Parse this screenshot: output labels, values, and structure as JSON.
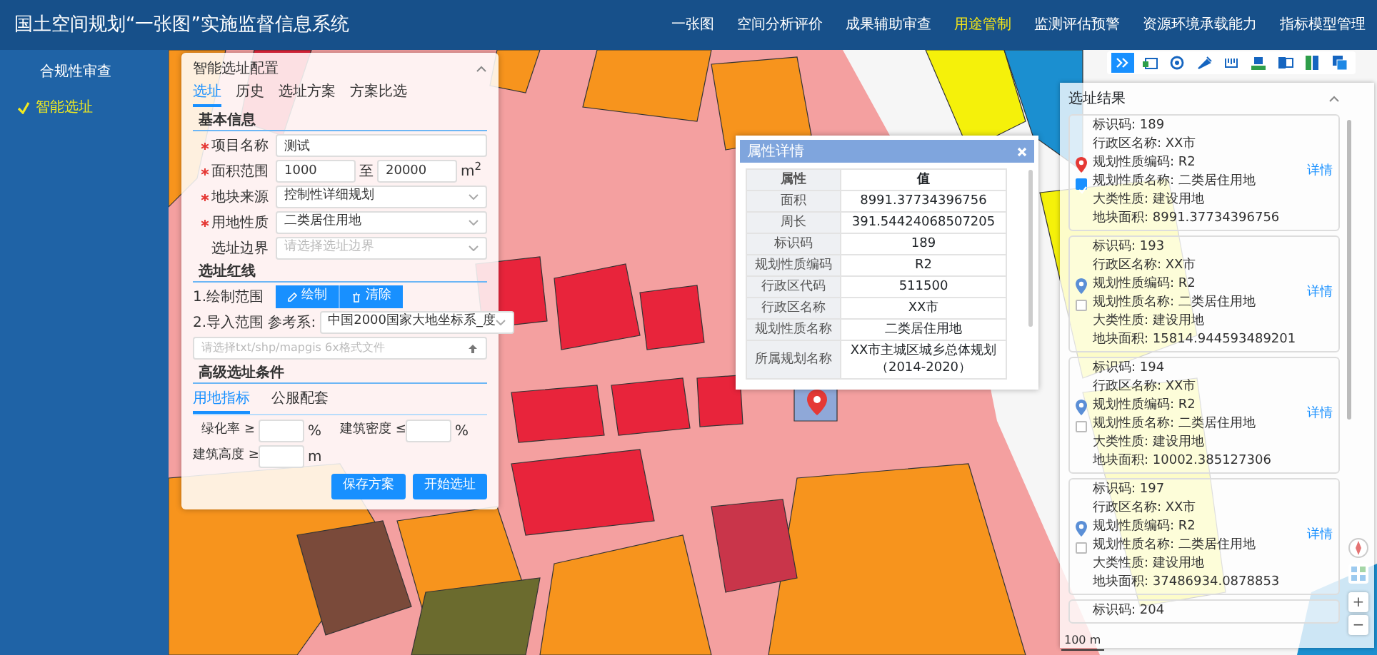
{
  "header": {
    "title": "国土空间规划“一张图”实施监督信息系统",
    "nav": [
      {
        "label": "一张图",
        "selected": false
      },
      {
        "label": "空间分析评价",
        "selected": false
      },
      {
        "label": "成果辅助审查",
        "selected": false
      },
      {
        "label": "用途管制",
        "selected": true
      },
      {
        "label": "监测评估预警",
        "selected": false
      },
      {
        "label": "资源环境承载能力",
        "selected": false
      },
      {
        "label": "指标模型管理",
        "selected": false
      }
    ]
  },
  "sidebar": {
    "items": [
      {
        "label": "合规性审查",
        "selected": false
      },
      {
        "label": "智能选址",
        "selected": true
      }
    ]
  },
  "config_panel": {
    "title": "智能选址配置",
    "tabs": [
      {
        "label": "选址",
        "selected": true
      },
      {
        "label": "历史",
        "selected": false
      },
      {
        "label": "选址方案",
        "selected": false
      },
      {
        "label": "方案比选",
        "selected": false
      }
    ],
    "basic_section": "基本信息",
    "fields": [
      {
        "kind": "text",
        "label": "项目名称",
        "required": true,
        "value": "测试"
      },
      {
        "kind": "range",
        "label": "面积范围",
        "required": true,
        "from": "1000",
        "separator": "至",
        "to": "20000",
        "unit": "m$^{2}$"
      },
      {
        "kind": "select",
        "label": "地块来源",
        "required": true,
        "value": "控制性详细规划"
      },
      {
        "kind": "select",
        "label": "用地性质",
        "required": true,
        "value": "二类居住用地"
      },
      {
        "kind": "select",
        "label": "选址边界",
        "required": false,
        "placeholder": "请选择选址边界"
      }
    ],
    "redline_section": "选址红线",
    "draw_label": "1.绘制范围",
    "draw_buttons": [
      {
        "kind": "draw",
        "label": "绘制"
      },
      {
        "kind": "clear",
        "label": "清除"
      }
    ],
    "import_label": "2.导入范围 参考系:",
    "crs": "中国2000国家大地坐标系_度",
    "file_placeholder": "请选择txt/shp/mapgis 6x格式文件",
    "advanced_section": "高级选址条件",
    "advanced_tabs": [
      {
        "label": "用地指标",
        "selected": true
      },
      {
        "label": "公服配套",
        "selected": false
      }
    ],
    "conditions": [
      {
        "label": "绿化率 ≥",
        "unit": "%"
      },
      {
        "label": "建筑密度 ≤",
        "unit": "%"
      },
      {
        "label": "建筑高度 ≥",
        "unit": "m"
      }
    ],
    "buttons": [
      "保存方案",
      "开始选址"
    ]
  },
  "popup": {
    "title": "属性详情",
    "columns": [
      "属性",
      "值"
    ],
    "rows": [
      [
        "面积",
        "8991.37734396756"
      ],
      [
        "周长",
        "391.54424068507205"
      ],
      [
        "标识码",
        "189"
      ],
      [
        "规划性质编码",
        "R2"
      ],
      [
        "行政区代码",
        "511500"
      ],
      [
        "行政区名称",
        "XX市"
      ],
      [
        "规划性质名称",
        "二类居住用地"
      ],
      [
        "所属规划名称",
        "XX市主城区城乡总体规划（2014-2020）"
      ]
    ]
  },
  "toolbar": [
    {
      "selected": true
    },
    {
      "selected": false
    },
    {
      "selected": false
    },
    {
      "selected": false
    },
    {
      "selected": false
    },
    {
      "selected": false
    },
    {
      "selected": false
    },
    {
      "selected": false
    },
    {
      "selected": false
    }
  ],
  "results": {
    "title": "选址结果",
    "items": [
      {
        "selected": true,
        "checked": true,
        "action": "详情",
        "lines": [
          "标识码: 189",
          "行政区名称: XX市",
          "规划性质编码: R2",
          "规划性质名称: 二类居住用地",
          "大类性质: 建设用地",
          "地块面积: 8991.37734396756"
        ]
      },
      {
        "selected": false,
        "checked": false,
        "action": "详情",
        "lines": [
          "标识码: 193",
          "行政区名称: XX市",
          "规划性质编码: R2",
          "规划性质名称: 二类居住用地",
          "大类性质: 建设用地",
          "地块面积: 15814.944593489201"
        ]
      },
      {
        "selected": false,
        "checked": false,
        "action": "详情",
        "lines": [
          "标识码: 194",
          "行政区名称: XX市",
          "规划性质编码: R2",
          "规划性质名称: 二类居住用地",
          "大类性质: 建设用地",
          "地块面积: 10002.385127306"
        ]
      },
      {
        "selected": false,
        "checked": false,
        "action": "详情",
        "lines": [
          "标识码: 197",
          "行政区名称: XX市",
          "规划性质编码: R2",
          "规划性质名称: 二类居住用地",
          "大类性质: 建设用地",
          "地块面积: 37486934.0878853"
        ]
      },
      {
        "lines": [
          "标识码: 204"
        ]
      }
    ]
  },
  "zoom_controls": [
    "+",
    "−"
  ],
  "scale": "100 m"
}
